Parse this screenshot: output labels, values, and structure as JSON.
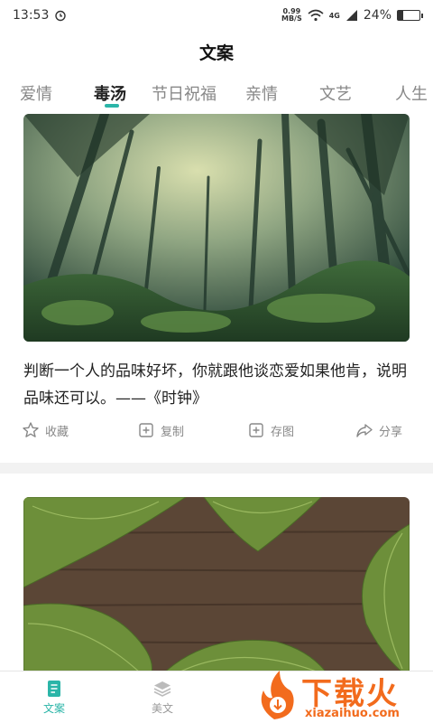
{
  "status": {
    "time": "13:53",
    "net_speed_value": "0.99",
    "net_speed_unit": "MB/S",
    "signal_label": "4G",
    "battery": "24%",
    "battery_level": 0.24
  },
  "header": {
    "title": "文案"
  },
  "tabs": [
    {
      "label": "爱情",
      "active": false
    },
    {
      "label": "毒汤",
      "active": true
    },
    {
      "label": "节日祝福",
      "active": false
    },
    {
      "label": "亲情",
      "active": false
    },
    {
      "label": "文艺",
      "active": false
    },
    {
      "label": "人生",
      "active": false
    }
  ],
  "cards": [
    {
      "image": "foggy-forest-photo",
      "text": "判断一个人的品味好坏，你就跟他谈恋爱如果他肯，说明品味还可以。——《时钟》"
    },
    {
      "image": "fern-leaves-on-wood-photo",
      "text": ""
    }
  ],
  "actions": {
    "favorite": "收藏",
    "copy": "复制",
    "save_image": "存图",
    "share": "分享"
  },
  "bottom_nav": [
    {
      "label": "文案",
      "active": true,
      "icon": "document-icon"
    },
    {
      "label": "美文",
      "active": false,
      "icon": "layers-icon"
    }
  ],
  "watermark": {
    "brand": "下载火",
    "site": "xiazaihuo.com"
  },
  "colors": {
    "accent": "#2bb5a8",
    "watermark_orange": "#f26b1d"
  }
}
